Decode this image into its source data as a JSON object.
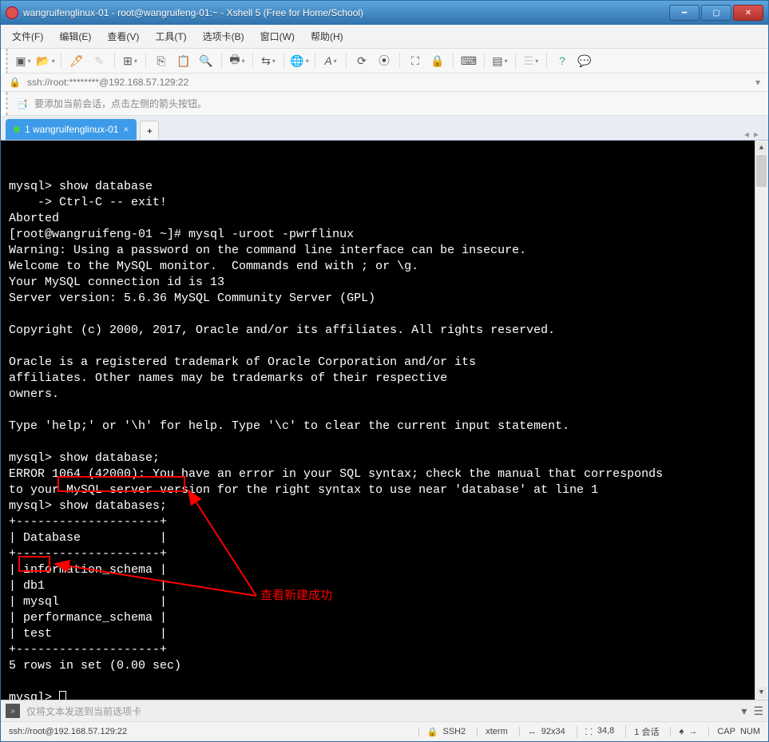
{
  "window": {
    "title": "wangruifenglinux-01 - root@wangruifeng-01:~ - Xshell 5 (Free for Home/School)"
  },
  "menu": [
    "文件(F)",
    "编辑(E)",
    "查看(V)",
    "工具(T)",
    "选项卡(B)",
    "窗口(W)",
    "帮助(H)"
  ],
  "address": "ssh://root:********@192.168.57.129:22",
  "hint": "要添加当前会话，点击左侧的箭头按钮。",
  "tab": {
    "label": "1 wangruifenglinux-01"
  },
  "terminal_lines": [
    "",
    "mysql> show database",
    "    -> Ctrl-C -- exit!",
    "Aborted",
    "[root@wangruifeng-01 ~]# mysql -uroot -pwrflinux",
    "Warning: Using a password on the command line interface can be insecure.",
    "Welcome to the MySQL monitor.  Commands end with ; or \\g.",
    "Your MySQL connection id is 13",
    "Server version: 5.6.36 MySQL Community Server (GPL)",
    "",
    "Copyright (c) 2000, 2017, Oracle and/or its affiliates. All rights reserved.",
    "",
    "Oracle is a registered trademark of Oracle Corporation and/or its",
    "affiliates. Other names may be trademarks of their respective",
    "owners.",
    "",
    "Type 'help;' or '\\h' for help. Type '\\c' to clear the current input statement.",
    "",
    "mysql> show database;",
    "ERROR 1064 (42000): You have an error in your SQL syntax; check the manual that corresponds",
    "to your MySQL server version for the right syntax to use near 'database' at line 1",
    "mysql> show databases;",
    "+--------------------+",
    "| Database           |",
    "+--------------------+",
    "| information_schema |",
    "| db1                |",
    "| mysql              |",
    "| performance_schema |",
    "| test               |",
    "+--------------------+",
    "5 rows in set (0.00 sec)",
    "",
    "mysql> "
  ],
  "annotation": "查看新建成功",
  "input_placeholder": "仅将文本发送到当前选项卡",
  "status": {
    "conn": "ssh://root@192.168.57.129:22",
    "proto": "SSH2",
    "term": "xterm",
    "size": "92x34",
    "pos": "34,8",
    "sessions": "1 会话",
    "cap": "CAP",
    "num": "NUM"
  },
  "chart_data": {
    "type": "table",
    "title": "show databases;",
    "columns": [
      "Database"
    ],
    "rows": [
      [
        "information_schema"
      ],
      [
        "db1"
      ],
      [
        "mysql"
      ],
      [
        "performance_schema"
      ],
      [
        "test"
      ]
    ],
    "footer": "5 rows in set (0.00 sec)"
  }
}
